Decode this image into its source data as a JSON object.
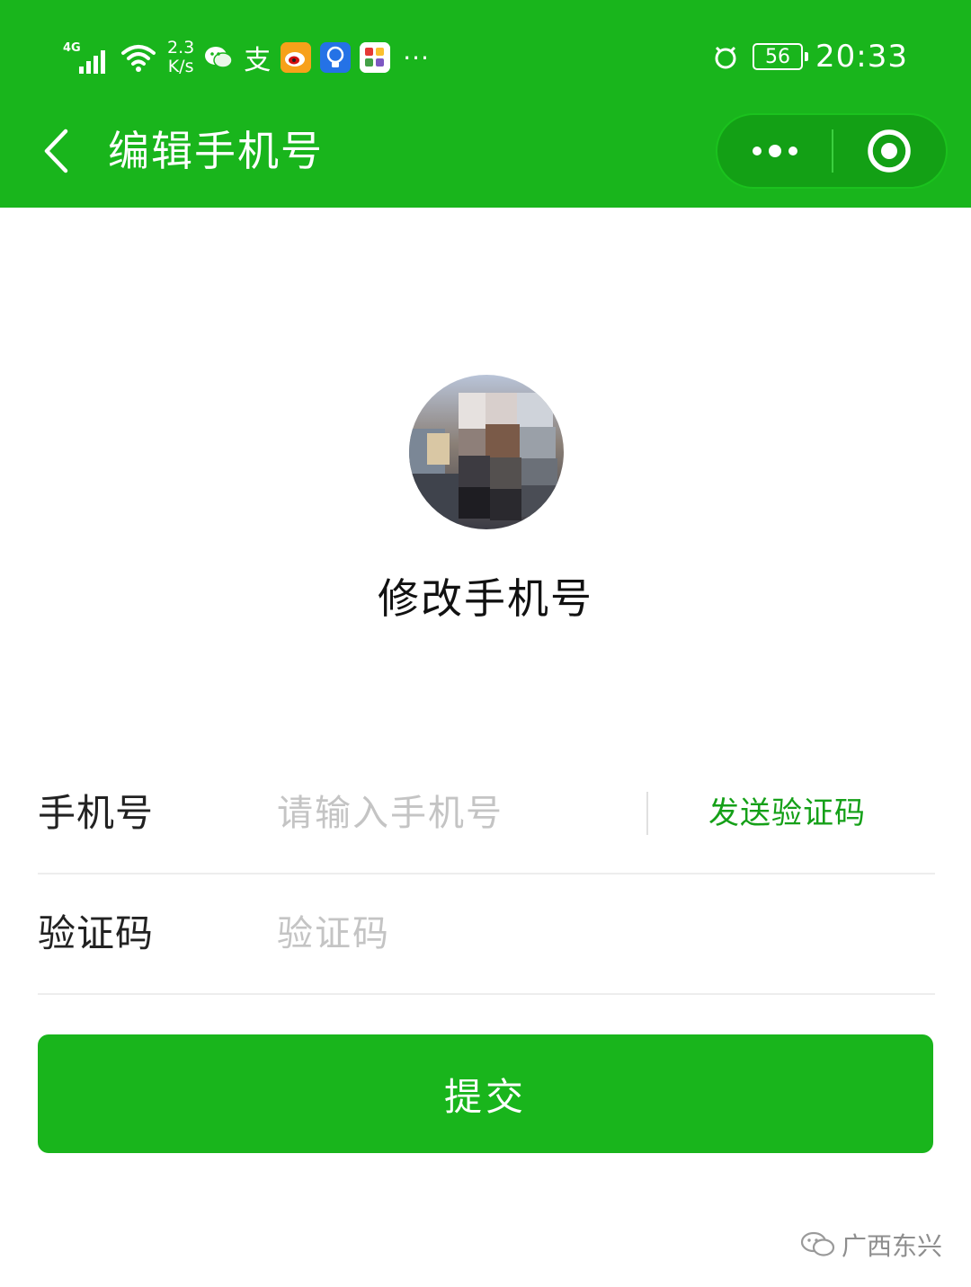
{
  "status_bar": {
    "network": "4G",
    "speed_value": "2.3",
    "speed_unit": "K/s",
    "more_indicator": "···",
    "battery_level": "56",
    "time": "20:33",
    "icons": [
      "signal-icon",
      "wifi-icon",
      "wechat-icon",
      "alipay-icon",
      "weibo-icon",
      "bulb-icon",
      "multicolor-app-icon",
      "alarm-icon",
      "battery-icon"
    ],
    "alipay_glyph": "支"
  },
  "nav": {
    "title": "编辑手机号",
    "back_icon": "chevron-left-icon",
    "capsule_more_icon": "more-dots-icon",
    "capsule_close_icon": "target-close-icon"
  },
  "profile": {
    "title": "修改手机号"
  },
  "form": {
    "phone_label": "手机号",
    "phone_placeholder": "请输入手机号",
    "phone_value": "",
    "send_code_label": "发送验证码",
    "code_label": "验证码",
    "code_placeholder": "验证码",
    "code_value": ""
  },
  "submit_label": "提交",
  "watermark": {
    "text": "广西东兴",
    "icon": "wechat-official-icon"
  },
  "colors": {
    "brand_green": "#19b51c",
    "link_green": "#15a018",
    "placeholder_gray": "#c4c4c4",
    "divider_gray": "#ededed"
  }
}
